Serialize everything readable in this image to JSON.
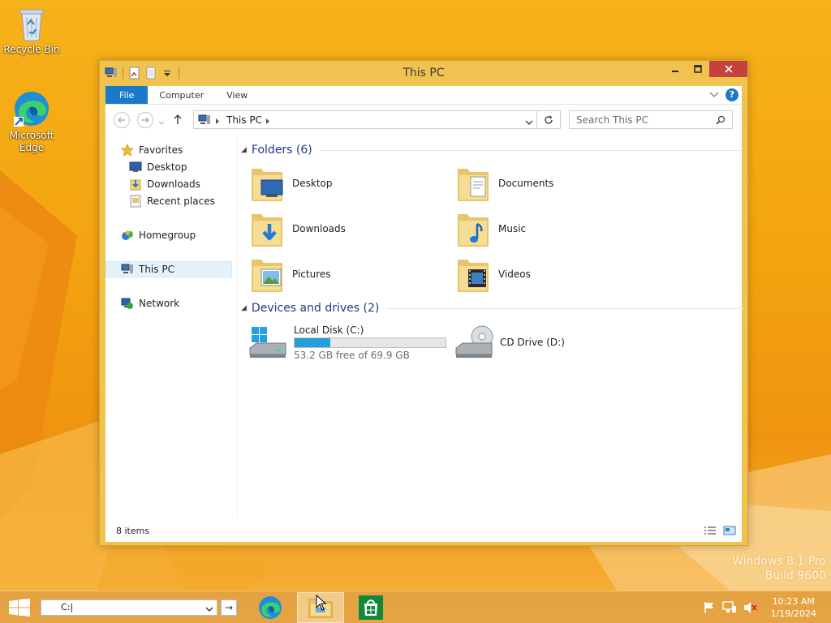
{
  "desktop": {
    "icons": [
      {
        "label": "Recycle Bin",
        "icon": "recycle-bin-icon"
      },
      {
        "label": "Microsoft Edge",
        "icon": "edge-icon"
      }
    ],
    "watermark": {
      "line1": "Windows 8.1 Pro",
      "line2": "Build 9600"
    }
  },
  "window": {
    "title": "This PC",
    "ribbon": {
      "tabs": [
        {
          "label": "File"
        },
        {
          "label": "Computer"
        },
        {
          "label": "View"
        }
      ],
      "help": "?"
    },
    "address": {
      "path": "This PC"
    },
    "search": {
      "placeholder": "Search This PC"
    },
    "nav_pane": {
      "favorites": "Favorites",
      "favorite_items": [
        {
          "label": "Desktop"
        },
        {
          "label": "Downloads"
        },
        {
          "label": "Recent places"
        }
      ],
      "homegroup": "Homegroup",
      "this_pc": "This PC",
      "network": "Network"
    },
    "folders_header": "Folders (6)",
    "folders": [
      {
        "label": "Desktop"
      },
      {
        "label": "Documents"
      },
      {
        "label": "Downloads"
      },
      {
        "label": "Music"
      },
      {
        "label": "Pictures"
      },
      {
        "label": "Videos"
      }
    ],
    "devices_header": "Devices and drives (2)",
    "drives": [
      {
        "label": "Local Disk (C:)",
        "free_text": "53.2 GB free of 69.9 GB",
        "used_fraction": 0.239
      },
      {
        "label": "CD Drive (D:)"
      }
    ],
    "status": "8 items"
  },
  "taskbar": {
    "run_value": "C:|",
    "run_go": "→",
    "clock": {
      "time": "10:23 AM",
      "date": "1/19/2024"
    }
  },
  "colors": {
    "accent": "#1979ca",
    "window_frame": "#f0c350",
    "close": "#c7413b",
    "drive_bar": "#26a0da"
  }
}
